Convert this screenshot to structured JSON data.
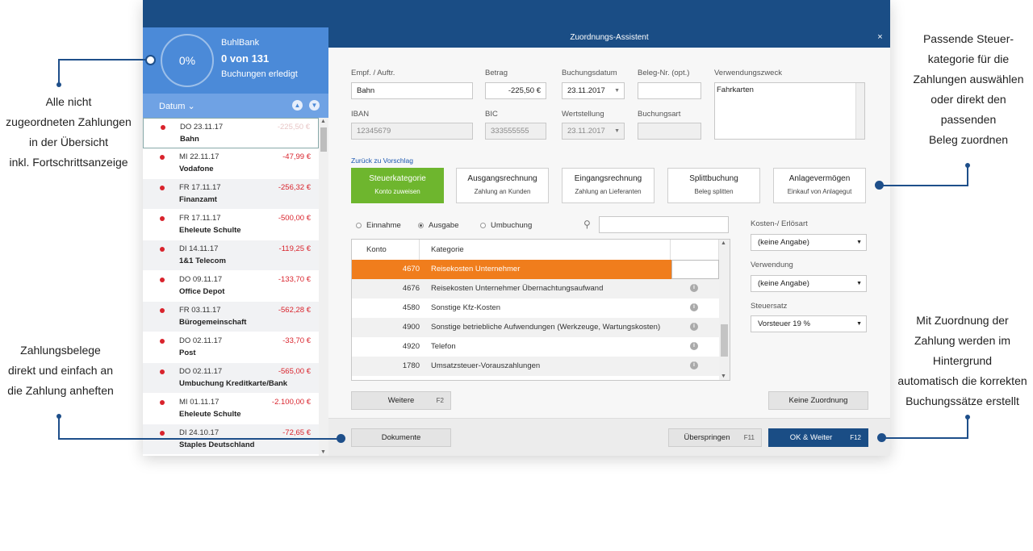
{
  "callouts": {
    "top_left": [
      "Alle nicht",
      "zugeordneten Zahlungen",
      "in der Übersicht",
      "inkl. Fortschrittsanzeige"
    ],
    "bottom_left": [
      "Zahlungsbelege",
      "direkt und einfach an",
      "die Zahlung anheften"
    ],
    "top_right": [
      "Passende Steuer-",
      "kategorie für die",
      "Zahlungen auswählen",
      "oder direkt den",
      "passenden",
      "Beleg zuordnen"
    ],
    "bottom_right": [
      "Mit Zuordnung der",
      "Zahlung werden im",
      "Hintergrund",
      "automatisch die korrekten",
      "Buchungssätze erstellt"
    ]
  },
  "left_panel": {
    "progress": "0%",
    "progress_fraction": 0,
    "bank_name": "BuhlBank",
    "count": "0 von 131",
    "done_label": "Buchungen erledigt",
    "sort_label": "Datum",
    "transactions": [
      {
        "date": "DO 23.11.17",
        "payee": "Bahn",
        "amount": "-225,50 €"
      },
      {
        "date": "MI 22.11.17",
        "payee": "Vodafone",
        "amount": "-47,99 €"
      },
      {
        "date": "FR 17.11.17",
        "payee": "Finanzamt",
        "amount": "-256,32 €"
      },
      {
        "date": "FR 17.11.17",
        "payee": "Eheleute Schulte",
        "amount": "-500,00 €"
      },
      {
        "date": "DI 14.11.17",
        "payee": "1&1 Telecom",
        "amount": "-119,25 €"
      },
      {
        "date": "DO 09.11.17",
        "payee": "Office Depot",
        "amount": "-133,70 €"
      },
      {
        "date": "FR 03.11.17",
        "payee": "Bürogemeinschaft",
        "amount": "-562,28 €"
      },
      {
        "date": "DO 02.11.17",
        "payee": "Post",
        "amount": "-33,70 €"
      },
      {
        "date": "DO 02.11.17",
        "payee": "Umbuchung Kreditkarte/Bank",
        "amount": "-565,00 €"
      },
      {
        "date": "MI 01.11.17",
        "payee": "Eheleute Schulte",
        "amount": "-2.100,00 €"
      },
      {
        "date": "DI 24.10.17",
        "payee": "Staples Deutschland",
        "amount": "-72,65 €"
      }
    ]
  },
  "dialog": {
    "title": "Zuordnungs-Assistent",
    "close": "×",
    "fields": {
      "recipient_label": "Empf. / Auftr.",
      "recipient_value": "Bahn",
      "amount_label": "Betrag",
      "amount_value": "-225,50 €",
      "booking_date_label": "Buchungsdatum",
      "booking_date_value": "23.11.2017",
      "receipt_no_label": "Beleg-Nr. (opt.)",
      "receipt_no_value": "",
      "purpose_label": "Verwendungszweck",
      "purpose_value": "Fahrkarten",
      "iban_label": "IBAN",
      "iban_value": "12345679",
      "bic_label": "BIC",
      "bic_value": "333555555",
      "value_date_label": "Wertstellung",
      "value_date_value": "23.11.2017",
      "booking_type_label": "Buchungsart",
      "booking_type_value": ""
    },
    "back_link": "Zurück zu Vorschlag",
    "category_buttons": [
      {
        "title": "Steuerkategorie",
        "sub": "Konto zuweisen"
      },
      {
        "title": "Ausgangsrechnung",
        "sub": "Zahlung an Kunden"
      },
      {
        "title": "Eingangsrechnung",
        "sub": "Zahlung an Lieferanten"
      },
      {
        "title": "Splittbuchung",
        "sub": "Beleg splitten"
      },
      {
        "title": "Anlagevermögen",
        "sub": "Einkauf von Anlagegut"
      }
    ],
    "radios": [
      "Einnahme",
      "Ausgabe",
      "Umbuchung"
    ],
    "radio_selected": "Ausgabe",
    "search_value": "",
    "table": {
      "headers": [
        "Konto",
        "Kategorie"
      ],
      "rows": [
        {
          "konto": "4670",
          "kategorie": "Reisekosten Unternehmer"
        },
        {
          "konto": "4676",
          "kategorie": "Reisekosten Unternehmer Übernachtungsaufwand"
        },
        {
          "konto": "4580",
          "kategorie": "Sonstige Kfz-Kosten"
        },
        {
          "konto": "4900",
          "kategorie": "Sonstige betriebliche Aufwendungen (Werkzeuge, Wartungskosten)"
        },
        {
          "konto": "4920",
          "kategorie": "Telefon"
        },
        {
          "konto": "1780",
          "kategorie": "Umsatzsteuer-Vorauszahlungen"
        }
      ]
    },
    "right_fields": {
      "cost_type_label": "Kosten-/ Erlösart",
      "cost_type_value": "(keine Angabe)",
      "usage_label": "Verwendung",
      "usage_value": "(keine Angabe)",
      "tax_rate_label": "Steuersatz",
      "tax_rate_value": "Vorsteuer 19 %"
    },
    "buttons": {
      "next": "Weitere",
      "next_key": "F2",
      "no_assignment": "Keine Zuordnung",
      "documents": "Dokumente",
      "skip": "Überspringen",
      "skip_key": "F11",
      "ok": "OK & Weiter",
      "ok_key": "F12"
    }
  }
}
